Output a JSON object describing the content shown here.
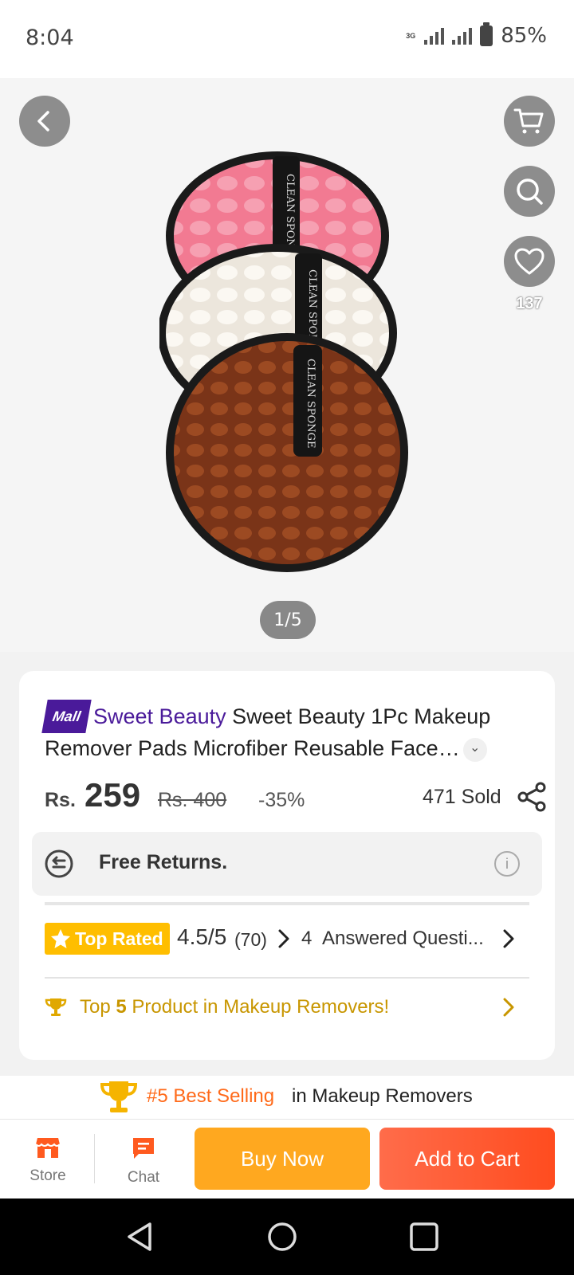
{
  "status_bar": {
    "time": "8:04",
    "network": "3G",
    "battery": "85%"
  },
  "gallery": {
    "favorite_count": "137",
    "page_indicator": "1/5",
    "product_strap_text": "CLEAN SPONGE"
  },
  "product": {
    "mall_badge": "Mall",
    "store_name": "Sweet Beauty",
    "title": "Sweet Beauty 1Pc Makeup Remover Pads Microfiber Reusable Face…",
    "currency": "Rs.",
    "price": "259",
    "original_price": "Rs. 400",
    "discount": "-35%",
    "sold": "471 Sold"
  },
  "returns": {
    "label": "Free Returns."
  },
  "rating": {
    "badge": "Top Rated",
    "score": "4.5/5",
    "count": "(70)",
    "questions_count": "4",
    "questions_label": "Answered Questi..."
  },
  "ranking": {
    "prefix": "Top ",
    "rank": "5",
    "suffix": " Product in Makeup Removers!"
  },
  "best_selling": {
    "rank_label": "#5 Best Selling",
    "category_label": "in Makeup Removers"
  },
  "actions": {
    "store_label": "Store",
    "chat_label": "Chat",
    "buy_now_label": "Buy Now",
    "add_to_cart_label": "Add to Cart"
  },
  "colors": {
    "mall_purple": "#4a1a9a",
    "top_rated_yellow": "#ffbe00",
    "ranking_gold": "#c89600",
    "best_selling_orange": "#ff6a1a",
    "buy_now_orange": "#ffa81f",
    "add_to_cart_red": "#ff4c1f"
  },
  "icons": [
    "back-icon",
    "cart-icon",
    "search-icon",
    "heart-icon",
    "share-icon",
    "returns-icon",
    "info-icon",
    "star-icon",
    "chevron-right-icon",
    "trophy-icon",
    "store-icon",
    "chat-icon",
    "nav-back-icon",
    "nav-home-icon",
    "nav-recents-icon"
  ]
}
